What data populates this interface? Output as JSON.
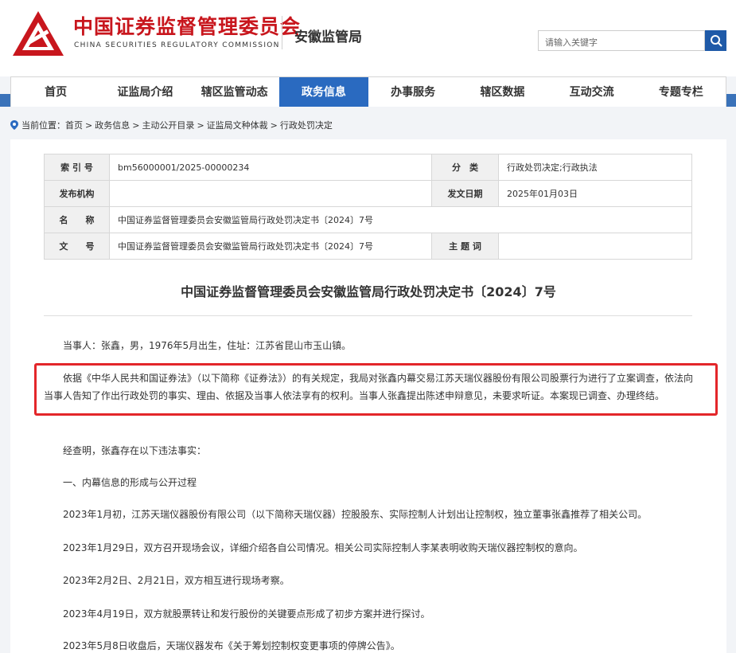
{
  "header": {
    "org_cn": "中国证券监督管理委员会",
    "org_en": "CHINA SECURITIES REGULATORY COMMISSION",
    "bureau": "安徽监管局",
    "search_placeholder": "请输入关键字",
    "logo_icon": "csrc-logo-icon",
    "search_icon": "magnifier-icon"
  },
  "nav": {
    "items": [
      "首页",
      "证监局介绍",
      "辖区监管动态",
      "政务信息",
      "办事服务",
      "辖区数据",
      "互动交流",
      "专题专栏"
    ],
    "active": "政务信息"
  },
  "breadcrumb": {
    "prefix": "当前位置：",
    "items": [
      "首页",
      "政务信息",
      "主动公开目录",
      "证监局文种体裁",
      "行政处罚决定"
    ]
  },
  "meta": {
    "index_label": "索 引 号",
    "index_value": "bm56000001/2025-00000234",
    "category_label": "分　类",
    "category_value": "行政处罚决定;行政执法",
    "publisher_label": "发布机构",
    "publisher_value": "",
    "date_label": "发文日期",
    "date_value": "2025年01月03日",
    "name_label": "名　　称",
    "name_value": "中国证券监督管理委员会安徽监管局行政处罚决定书〔2024〕7号",
    "docno_label": "文　　号",
    "docno_value": "中国证券监督管理委员会安徽监管局行政处罚决定书〔2024〕7号",
    "subject_label": "主 题 词",
    "subject_value": ""
  },
  "document": {
    "title": "中国证券监督管理委员会安徽监管局行政处罚决定书〔2024〕7号",
    "p1": "当事人：张鑫，男，1976年5月出生，住址：江苏省昆山市玉山镇。",
    "p2": "依据《中华人民共和国证券法》（以下简称《证券法》）的有关规定，我局对张鑫内幕交易江苏天瑞仪器股份有限公司股票行为进行了立案调查，依法向当事人告知了作出行政处罚的事实、理由、依据及当事人依法享有的权利。当事人张鑫提出陈述申辩意见，未要求听证。本案现已调查、办理终结。",
    "p3": "经查明，张鑫存在以下违法事实：",
    "p4": "一、内幕信息的形成与公开过程",
    "p5": "2023年1月初，江苏天瑞仪器股份有限公司（以下简称天瑞仪器）控股股东、实际控制人计划出让控制权，独立董事张鑫推荐了相关公司。",
    "p6": "2023年1月29日，双方召开现场会议，详细介绍各自公司情况。相关公司实际控制人李某表明收购天瑞仪器控制权的意向。",
    "p7": "2023年2月2日、2月21日，双方相互进行现场考察。",
    "p8": "2023年4月19日，双方就股票转让和发行股份的关键要点形成了初步方案并进行探讨。",
    "p9": "2023年5月8日收盘后，天瑞仪器发布《关于筹划控制权变更事项的停牌公告》。"
  }
}
